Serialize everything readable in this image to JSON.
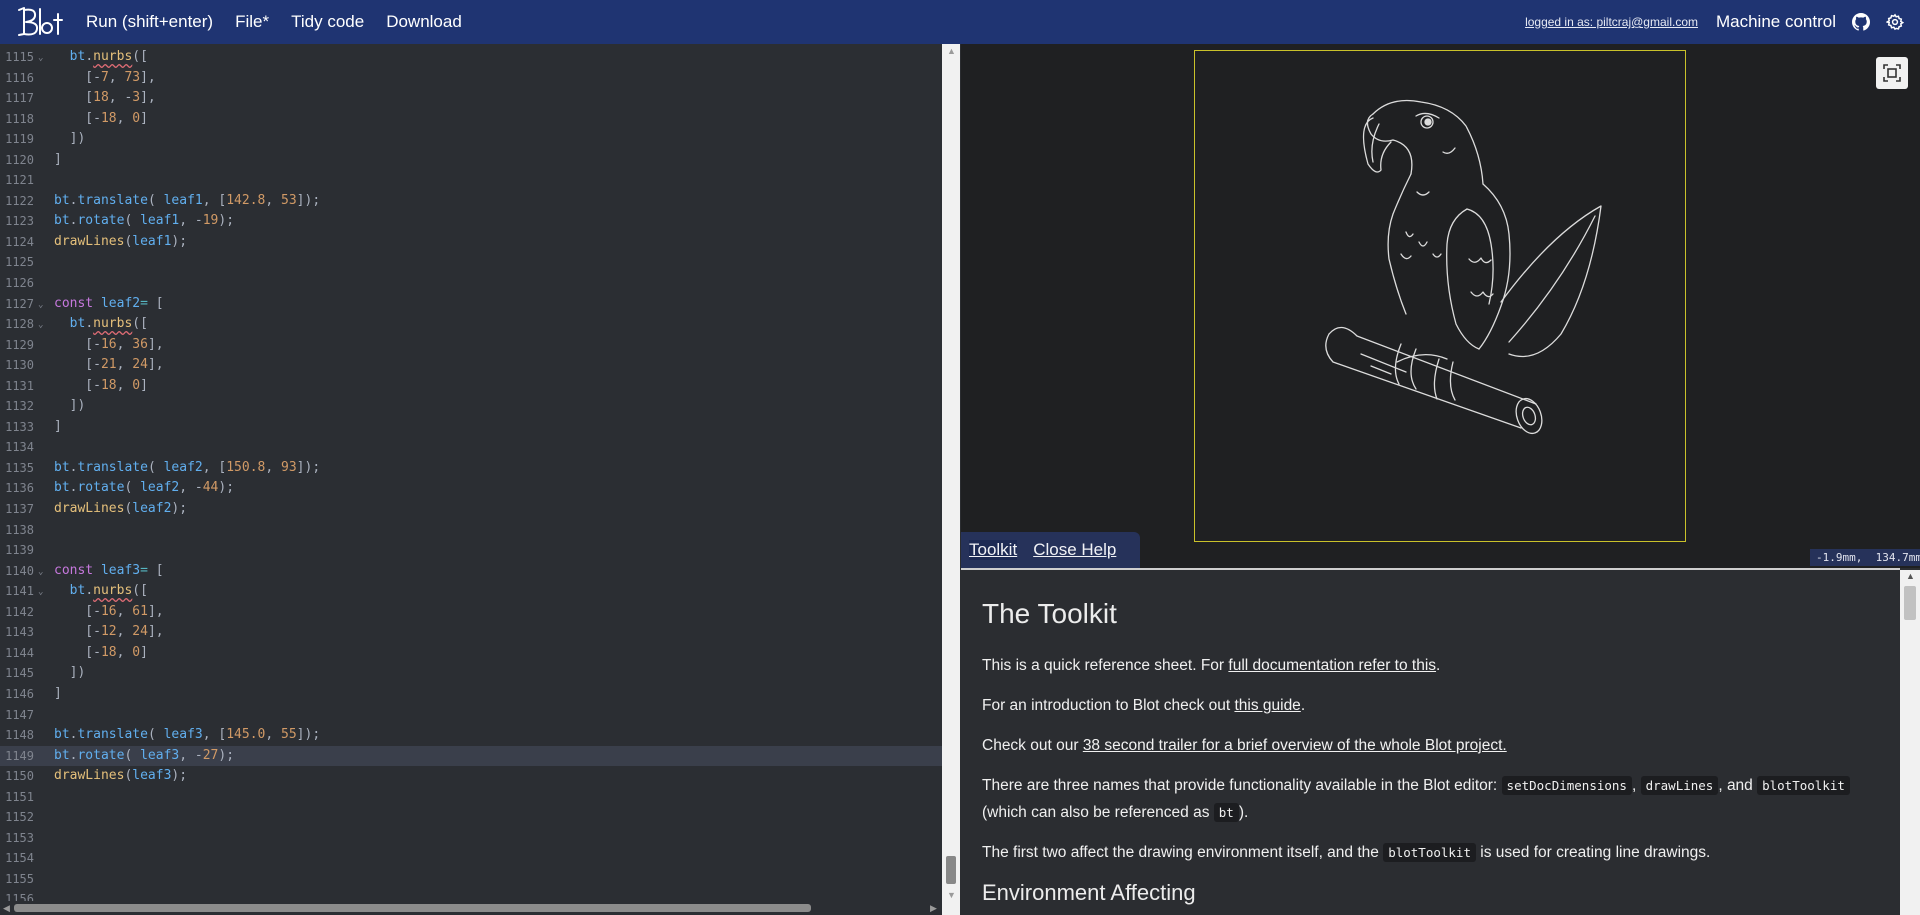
{
  "nav": {
    "run": "Run (shift+enter)",
    "file": "File*",
    "tidy": "Tidy code",
    "download": "Download",
    "login": "logged in as: piltcraj@gmail.com",
    "machine": "Machine control"
  },
  "editor": {
    "lines": [
      {
        "n": "1115",
        "fold": true,
        "segs": [
          [
            "p",
            "  "
          ],
          [
            "v",
            "bt"
          ],
          [
            "p",
            "."
          ],
          [
            "fs",
            "nurbs"
          ],
          [
            "p",
            "(["
          ]
        ]
      },
      {
        "n": "1116",
        "segs": [
          [
            "p",
            "    [-"
          ],
          [
            "n",
            "7"
          ],
          [
            "p",
            ", "
          ],
          [
            "n",
            "73"
          ],
          [
            "p",
            "],"
          ]
        ]
      },
      {
        "n": "1117",
        "segs": [
          [
            "p",
            "    ["
          ],
          [
            "n",
            "18"
          ],
          [
            "p",
            ", -"
          ],
          [
            "n",
            "3"
          ],
          [
            "p",
            "],"
          ]
        ]
      },
      {
        "n": "1118",
        "segs": [
          [
            "p",
            "    [-"
          ],
          [
            "n",
            "18"
          ],
          [
            "p",
            ", "
          ],
          [
            "n",
            "0"
          ],
          [
            "p",
            "]"
          ]
        ]
      },
      {
        "n": "1119",
        "segs": [
          [
            "p",
            "  ])"
          ]
        ]
      },
      {
        "n": "1120",
        "segs": [
          [
            "p",
            "]"
          ]
        ]
      },
      {
        "n": "1121",
        "segs": []
      },
      {
        "n": "1122",
        "segs": [
          [
            "v",
            "bt"
          ],
          [
            "p",
            "."
          ],
          [
            "v",
            "translate"
          ],
          [
            "p",
            "( "
          ],
          [
            "v",
            "leaf1"
          ],
          [
            "p",
            ", ["
          ],
          [
            "n",
            "142.8"
          ],
          [
            "p",
            ", "
          ],
          [
            "n",
            "53"
          ],
          [
            "p",
            "]);"
          ]
        ]
      },
      {
        "n": "1123",
        "segs": [
          [
            "v",
            "bt"
          ],
          [
            "p",
            "."
          ],
          [
            "v",
            "rotate"
          ],
          [
            "p",
            "( "
          ],
          [
            "v",
            "leaf1"
          ],
          [
            "p",
            ", -"
          ],
          [
            "n",
            "19"
          ],
          [
            "p",
            ");"
          ]
        ]
      },
      {
        "n": "1124",
        "segs": [
          [
            "f",
            "drawLines"
          ],
          [
            "p",
            "("
          ],
          [
            "v",
            "leaf1"
          ],
          [
            "p",
            ");"
          ]
        ]
      },
      {
        "n": "1125",
        "segs": []
      },
      {
        "n": "1126",
        "segs": []
      },
      {
        "n": "1127",
        "fold": true,
        "segs": [
          [
            "k",
            "const "
          ],
          [
            "v",
            "leaf2"
          ],
          [
            "m",
            "= "
          ],
          [
            "p",
            "["
          ]
        ]
      },
      {
        "n": "1128",
        "fold": true,
        "segs": [
          [
            "p",
            "  "
          ],
          [
            "v",
            "bt"
          ],
          [
            "p",
            "."
          ],
          [
            "fs",
            "nurbs"
          ],
          [
            "p",
            "(["
          ]
        ]
      },
      {
        "n": "1129",
        "segs": [
          [
            "p",
            "    [-"
          ],
          [
            "n",
            "16"
          ],
          [
            "p",
            ", "
          ],
          [
            "n",
            "36"
          ],
          [
            "p",
            "],"
          ]
        ]
      },
      {
        "n": "1130",
        "segs": [
          [
            "p",
            "    [-"
          ],
          [
            "n",
            "21"
          ],
          [
            "p",
            ", "
          ],
          [
            "n",
            "24"
          ],
          [
            "p",
            "],"
          ]
        ]
      },
      {
        "n": "1131",
        "segs": [
          [
            "p",
            "    [-"
          ],
          [
            "n",
            "18"
          ],
          [
            "p",
            ", "
          ],
          [
            "n",
            "0"
          ],
          [
            "p",
            "]"
          ]
        ]
      },
      {
        "n": "1132",
        "segs": [
          [
            "p",
            "  ])"
          ]
        ]
      },
      {
        "n": "1133",
        "segs": [
          [
            "p",
            "]"
          ]
        ]
      },
      {
        "n": "1134",
        "segs": []
      },
      {
        "n": "1135",
        "segs": [
          [
            "v",
            "bt"
          ],
          [
            "p",
            "."
          ],
          [
            "v",
            "translate"
          ],
          [
            "p",
            "( "
          ],
          [
            "v",
            "leaf2"
          ],
          [
            "p",
            ", ["
          ],
          [
            "n",
            "150.8"
          ],
          [
            "p",
            ", "
          ],
          [
            "n",
            "93"
          ],
          [
            "p",
            "]);"
          ]
        ]
      },
      {
        "n": "1136",
        "segs": [
          [
            "v",
            "bt"
          ],
          [
            "p",
            "."
          ],
          [
            "v",
            "rotate"
          ],
          [
            "p",
            "( "
          ],
          [
            "v",
            "leaf2"
          ],
          [
            "p",
            ", -"
          ],
          [
            "n",
            "44"
          ],
          [
            "p",
            ");"
          ]
        ]
      },
      {
        "n": "1137",
        "segs": [
          [
            "f",
            "drawLines"
          ],
          [
            "p",
            "("
          ],
          [
            "v",
            "leaf2"
          ],
          [
            "p",
            ");"
          ]
        ]
      },
      {
        "n": "1138",
        "segs": []
      },
      {
        "n": "1139",
        "segs": []
      },
      {
        "n": "1140",
        "fold": true,
        "segs": [
          [
            "k",
            "const "
          ],
          [
            "v",
            "leaf3"
          ],
          [
            "m",
            "= "
          ],
          [
            "p",
            "["
          ]
        ]
      },
      {
        "n": "1141",
        "fold": true,
        "segs": [
          [
            "p",
            "  "
          ],
          [
            "v",
            "bt"
          ],
          [
            "p",
            "."
          ],
          [
            "fs",
            "nurbs"
          ],
          [
            "p",
            "(["
          ]
        ]
      },
      {
        "n": "1142",
        "segs": [
          [
            "p",
            "    [-"
          ],
          [
            "n",
            "16"
          ],
          [
            "p",
            ", "
          ],
          [
            "n",
            "61"
          ],
          [
            "p",
            "],"
          ]
        ]
      },
      {
        "n": "1143",
        "segs": [
          [
            "p",
            "    [-"
          ],
          [
            "n",
            "12"
          ],
          [
            "p",
            ", "
          ],
          [
            "n",
            "24"
          ],
          [
            "p",
            "],"
          ]
        ]
      },
      {
        "n": "1144",
        "segs": [
          [
            "p",
            "    [-"
          ],
          [
            "n",
            "18"
          ],
          [
            "p",
            ", "
          ],
          [
            "n",
            "0"
          ],
          [
            "p",
            "]"
          ]
        ]
      },
      {
        "n": "1145",
        "segs": [
          [
            "p",
            "  ])"
          ]
        ]
      },
      {
        "n": "1146",
        "segs": [
          [
            "p",
            "]"
          ]
        ]
      },
      {
        "n": "1147",
        "segs": []
      },
      {
        "n": "1148",
        "segs": [
          [
            "v",
            "bt"
          ],
          [
            "p",
            "."
          ],
          [
            "v",
            "translate"
          ],
          [
            "p",
            "( "
          ],
          [
            "v",
            "leaf3"
          ],
          [
            "p",
            ", ["
          ],
          [
            "n",
            "145.0"
          ],
          [
            "p",
            ", "
          ],
          [
            "n",
            "55"
          ],
          [
            "p",
            "]);"
          ]
        ]
      },
      {
        "n": "1149",
        "active": true,
        "segs": [
          [
            "v",
            "bt"
          ],
          [
            "p",
            "."
          ],
          [
            "v",
            "rotate"
          ],
          [
            "p",
            "( "
          ],
          [
            "v",
            "leaf3"
          ],
          [
            "p",
            ", -"
          ],
          [
            "n",
            "27"
          ],
          [
            "p",
            ");"
          ]
        ]
      },
      {
        "n": "1150",
        "segs": [
          [
            "f",
            "drawLines"
          ],
          [
            "p",
            "("
          ],
          [
            "v",
            "leaf3"
          ],
          [
            "p",
            ");"
          ]
        ]
      },
      {
        "n": "1151",
        "segs": []
      },
      {
        "n": "1152",
        "segs": []
      },
      {
        "n": "1153",
        "segs": []
      },
      {
        "n": "1154",
        "segs": []
      },
      {
        "n": "1155",
        "segs": []
      },
      {
        "n": "1156",
        "segs": []
      }
    ]
  },
  "preview": {
    "coords": "-1.9mm,  134.7mm",
    "icon": "fullscreen-icon"
  },
  "help_tabs": {
    "toolkit": "Toolkit",
    "close": "Close Help"
  },
  "help": {
    "title": "The Toolkit",
    "p1_pre": "This is a quick reference sheet. For ",
    "p1_link": "full documentation refer to this",
    "p1_post": ".",
    "p2_pre": "For an introduction to Blot check out ",
    "p2_link": "this guide",
    "p2_post": ".",
    "p3_pre": "Check out our ",
    "p3_link": "38 second trailer for a brief overview of the whole Blot project.",
    "p4_pre": "There are three names that provide functionality available in the Blot editor: ",
    "p4_c1": "setDocDimensions",
    "p4_sep1": ", ",
    "p4_c2": "drawLines",
    "p4_sep2": ", and ",
    "p4_c3": "blotToolkit",
    "p4_mid": " (which can also be referenced as ",
    "p4_c4": "bt",
    "p4_post": ").",
    "p5_pre": "The first two affect the drawing environment itself, and the ",
    "p5_c": "blotToolkit",
    "p5_post": " is used for creating line drawings.",
    "h2": "Environment Affecting"
  },
  "colors": {
    "nav_bg": "#1f3472",
    "editor_bg": "#2b2e33",
    "preview_bg": "#1f2022",
    "doc_border": "#c9c12a",
    "active_line": "#3a3f4b"
  }
}
